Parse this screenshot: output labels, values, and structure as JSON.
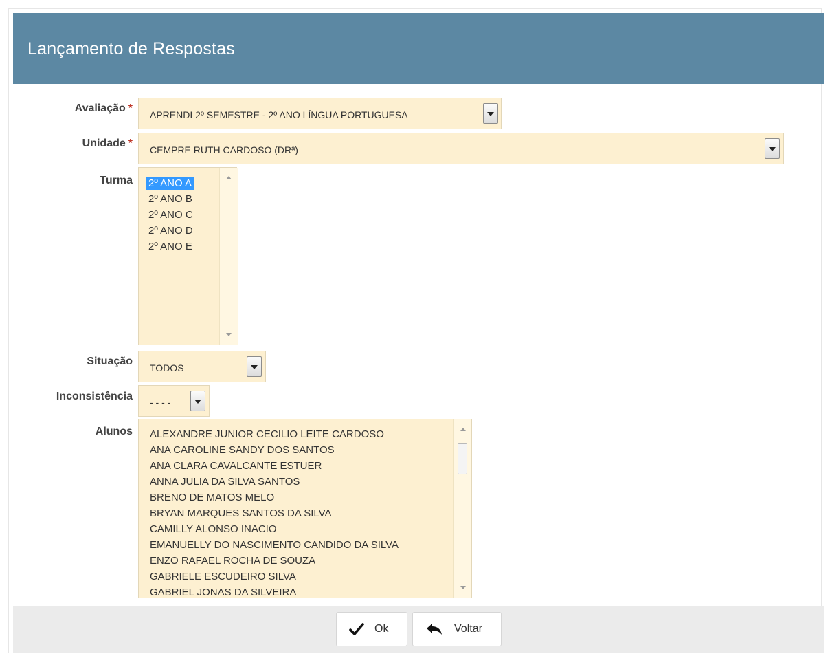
{
  "header": {
    "title": "Lançamento de Respostas"
  },
  "form": {
    "avaliacao": {
      "label": "Avaliação",
      "required_mark": "*",
      "value": "APRENDI 2º SEMESTRE - 2º ANO LÍNGUA PORTUGUESA"
    },
    "unidade": {
      "label": "Unidade",
      "required_mark": "*",
      "value": "CEMPRE RUTH CARDOSO (DRª)"
    },
    "turma": {
      "label": "Turma",
      "options": [
        "2º ANO A",
        "2º ANO B",
        "2º ANO C",
        "2º ANO D",
        "2º ANO E"
      ],
      "selected": "2º ANO A"
    },
    "situacao": {
      "label": "Situação",
      "value": "TODOS"
    },
    "inconsistencia": {
      "label": "Inconsistência",
      "value": "- - - -"
    },
    "alunos": {
      "label": "Alunos",
      "options": [
        "ALEXANDRE JUNIOR CECILIO LEITE CARDOSO",
        "ANA CAROLINE SANDY DOS SANTOS",
        "ANA CLARA CAVALCANTE ESTUER",
        "ANNA JULIA DA SILVA SANTOS",
        "BRENO DE MATOS MELO",
        "BRYAN MARQUES SANTOS DA SILVA",
        "CAMILLY ALONSO INACIO",
        "EMANUELLY DO NASCIMENTO CANDIDO DA SILVA",
        "ENZO RAFAEL ROCHA DE SOUZA",
        "GABRIELE ESCUDEIRO SILVA",
        "GABRIEL JONAS DA SILVEIRA"
      ]
    }
  },
  "buttons": {
    "ok": "Ok",
    "voltar": "Voltar"
  },
  "colors": {
    "header_bg": "#5c88a3",
    "field_bg": "#fdf0d1",
    "selection": "#3399ff",
    "required": "#c0392b"
  }
}
